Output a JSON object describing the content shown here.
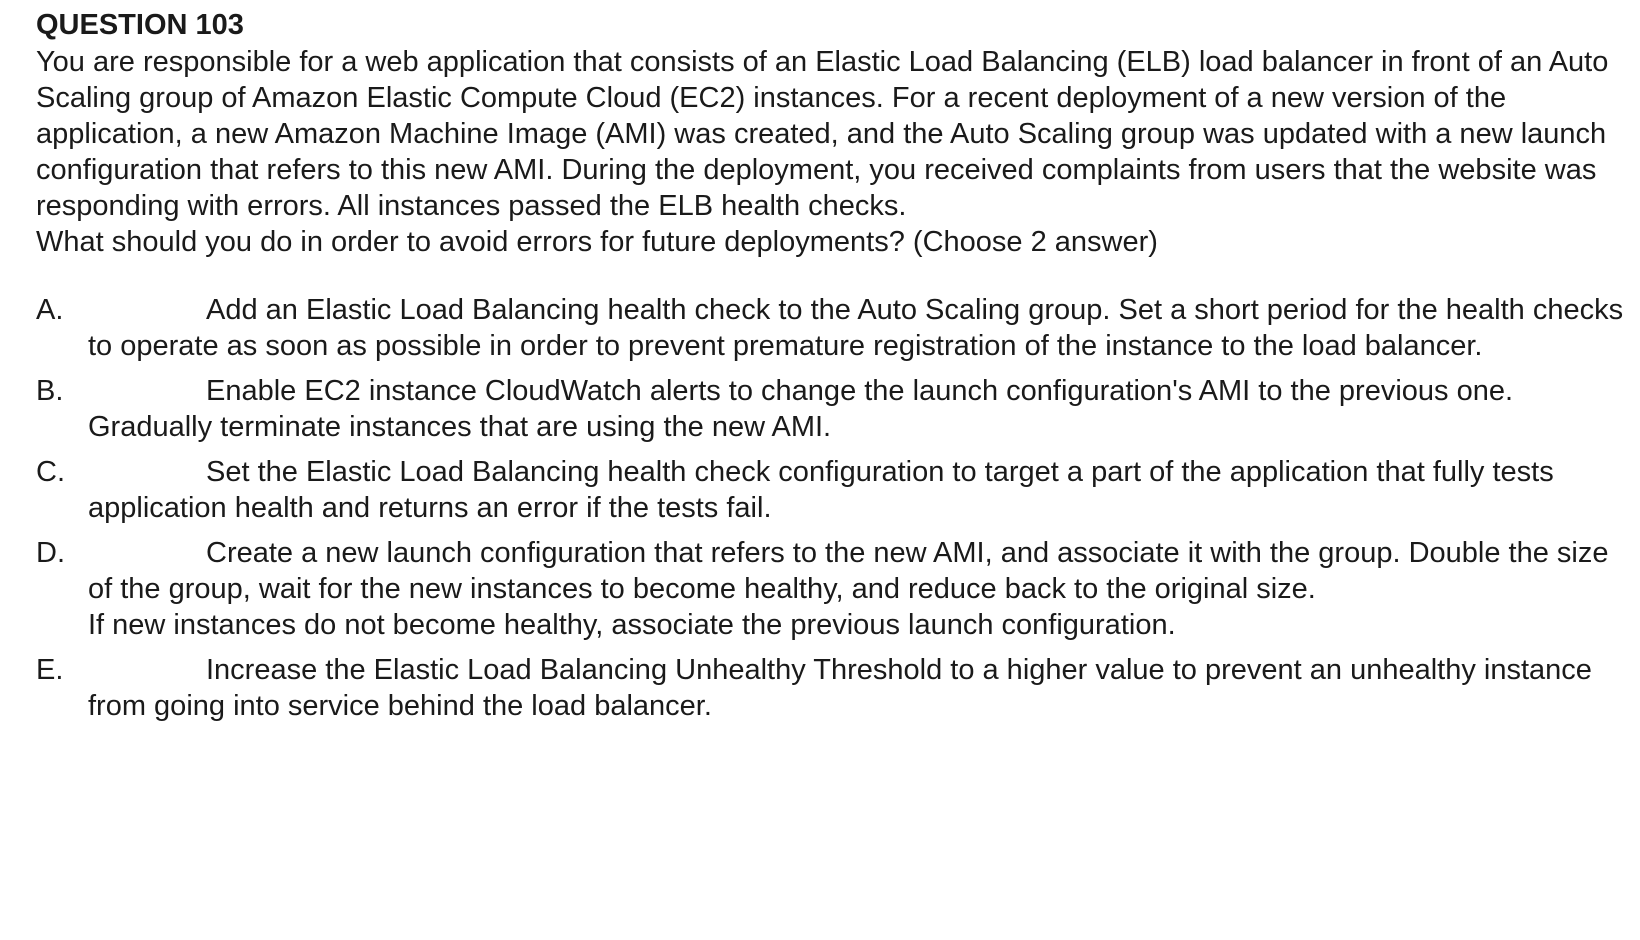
{
  "question": {
    "title": "QUESTION 103",
    "body": "You are responsible for a web application that consists of an Elastic Load Balancing (ELB) load balancer in front of an Auto Scaling group of Amazon Elastic Compute Cloud (EC2) instances. For a recent deployment of a new version of the application, a new Amazon Machine Image (AMI) was created, and the Auto Scaling group was updated with a new launch configuration that refers to this new AMI. During the deployment, you received complaints from users that the website was responding with errors. All instances passed the ELB health checks.",
    "prompt": "What should you do in order to avoid errors for future deployments? (Choose 2 answer)"
  },
  "options": [
    {
      "letter": "A.",
      "text": "Add an Elastic Load Balancing health check to the Auto Scaling group. Set a short period for the health checks to operate as soon as possible in order to prevent premature registration of the instance to the load balancer.",
      "cont": ""
    },
    {
      "letter": "B.",
      "text": "Enable EC2 instance CloudWatch alerts to change the launch configuration's AMI to the previous one.",
      "cont": "Gradually terminate instances that are using the new AMI."
    },
    {
      "letter": "C.",
      "text": "Set the Elastic Load Balancing health check configuration to target a part of the application that fully tests application health and returns an error if the tests fail.",
      "cont": ""
    },
    {
      "letter": "D.",
      "text": "Create a new launch configuration that refers to the new AMI, and associate it with the group. Double the size of the group, wait for the new instances to become healthy, and reduce back to the original size.",
      "cont": "If new instances do not become healthy, associate the previous launch configuration."
    },
    {
      "letter": "E.",
      "text": "Increase the Elastic Load Balancing Unhealthy Threshold to a higher value to prevent an unhealthy instance from going into service behind the load balancer.",
      "cont": ""
    }
  ]
}
